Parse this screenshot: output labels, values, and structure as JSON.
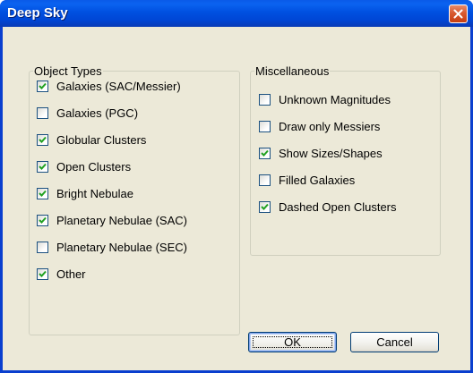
{
  "window": {
    "title": "Deep Sky"
  },
  "object_types": {
    "legend": "Object Types",
    "items": [
      {
        "label": "Galaxies (SAC/Messier)",
        "checked": true
      },
      {
        "label": "Galaxies (PGC)",
        "checked": false
      },
      {
        "label": "Globular Clusters",
        "checked": true
      },
      {
        "label": "Open Clusters",
        "checked": true
      },
      {
        "label": "Bright Nebulae",
        "checked": true
      },
      {
        "label": "Planetary Nebulae (SAC)",
        "checked": true
      },
      {
        "label": "Planetary Nebulae (SEC)",
        "checked": false
      },
      {
        "label": "Other",
        "checked": true
      }
    ]
  },
  "miscellaneous": {
    "legend": "Miscellaneous",
    "items": [
      {
        "label": "Unknown Magnitudes",
        "checked": false
      },
      {
        "label": "Draw only Messiers",
        "checked": false
      },
      {
        "label": "Show Sizes/Shapes",
        "checked": true
      },
      {
        "label": "Filled Galaxies",
        "checked": false
      },
      {
        "label": "Dashed Open Clusters",
        "checked": true
      }
    ]
  },
  "buttons": {
    "ok_label": "OK",
    "cancel_label": "Cancel"
  },
  "icons": {
    "close": "close-icon",
    "checkmark": "checkmark-icon"
  },
  "colors": {
    "titlebar": "#0050e0",
    "close_button": "#d85a30",
    "client_background": "#ece9d8",
    "checkbox_border": "#1c5180",
    "checkmark": "#21a121"
  }
}
